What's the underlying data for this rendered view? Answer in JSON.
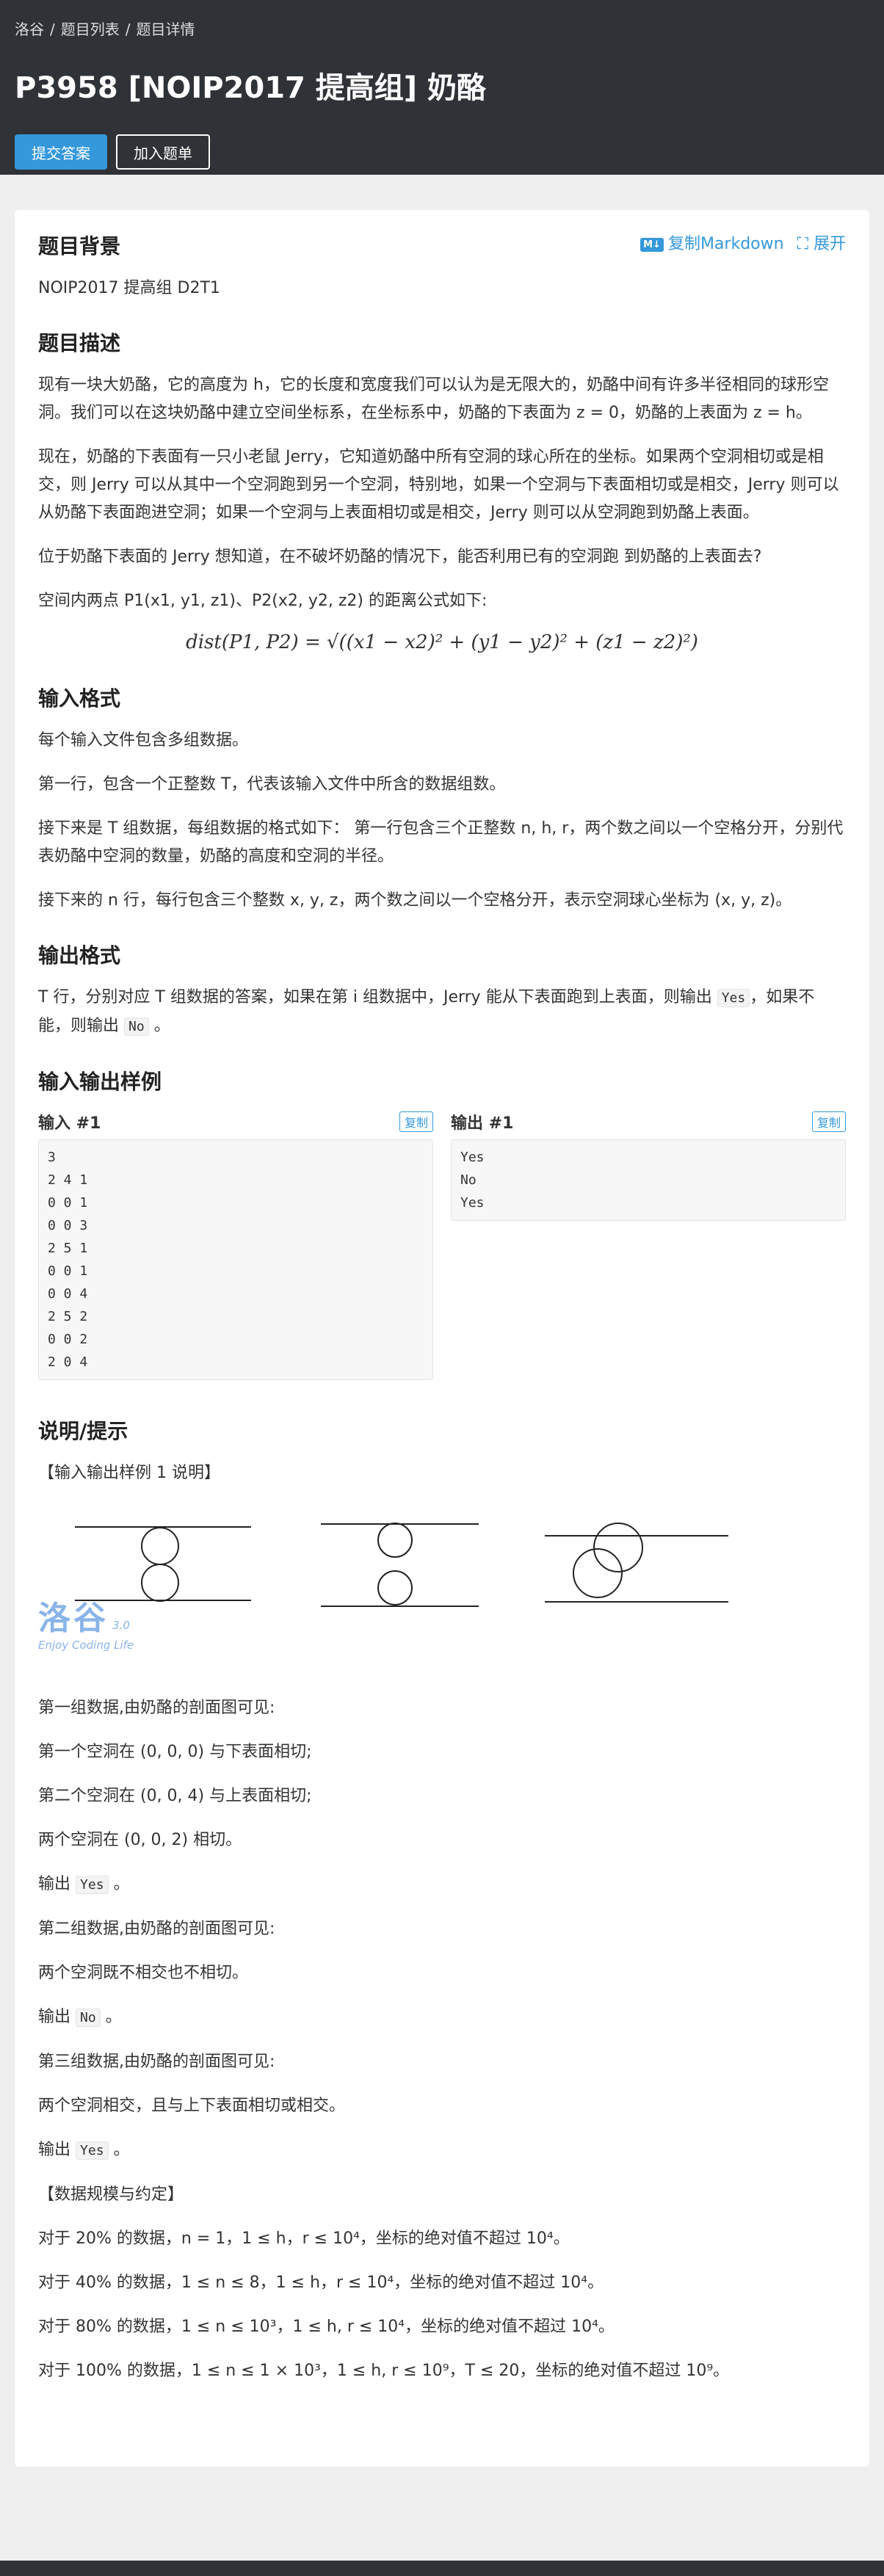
{
  "breadcrumb": [
    "洛谷",
    "题目列表",
    "题目详情"
  ],
  "title": "P3958 [NOIP2017 提高组] 奶酪",
  "actions": {
    "submit": "提交答案",
    "add": "加入题单"
  },
  "tools": {
    "md_badge": "M↓",
    "copy_md": "复制Markdown",
    "expand": "展开"
  },
  "background": {
    "title": "题目背景",
    "text": "NOIP2017 提高组 D2T1"
  },
  "description": {
    "title": "题目描述",
    "p1": "现有一块大奶酪，它的高度为 h，它的长度和宽度我们可以认为是无限大的，奶酪中间有许多半径相同的球形空洞。我们可以在这块奶酪中建立空间坐标系，在坐标系中，奶酪的下表面为 z = 0，奶酪的上表面为 z = h。",
    "p2": "现在，奶酪的下表面有一只小老鼠 Jerry，它知道奶酪中所有空洞的球心所在的坐标。如果两个空洞相切或是相交，则 Jerry 可以从其中一个空洞跑到另一个空洞，特别地，如果一个空洞与下表面相切或是相交，Jerry 则可以从奶酪下表面跑进空洞；如果一个空洞与上表面相切或是相交，Jerry 则可以从空洞跑到奶酪上表面。",
    "p3": "位于奶酪下表面的 Jerry 想知道，在不破坏奶酪的情况下，能否利用已有的空洞跑 到奶酪的上表面去?",
    "p4": "空间内两点 P1(x1, y1, z1)、P2(x2, y2, z2) 的距离公式如下:",
    "formula": "dist(P1, P2) = √((x1 − x2)² + (y1 − y2)² + (z1 − z2)²)"
  },
  "input_format": {
    "title": "输入格式",
    "p1": "每个输入文件包含多组数据。",
    "p2": "第一行，包含一个正整数 T，代表该输入文件中所含的数据组数。",
    "p3": "接下来是 T 组数据，每组数据的格式如下： 第一行包含三个正整数 n, h, r，两个数之间以一个空格分开，分别代表奶酪中空洞的数量，奶酪的高度和空洞的半径。",
    "p4": "接下来的 n 行，每行包含三个整数 x, y, z，两个数之间以一个空格分开，表示空洞球心坐标为 (x, y, z)。"
  },
  "output_format": {
    "title": "输出格式",
    "pre": "T 行，分别对应 T 组数据的答案，如果在第 i 组数据中，Jerry 能从下表面跑到上表面，则输出",
    "yes": "Yes",
    "mid": "，如果不能，则输出",
    "no": "No",
    "end": "。"
  },
  "samples": {
    "title": "输入输出样例",
    "input_title": "输入 #1",
    "output_title": "输出 #1",
    "copy": "复制",
    "input": "3\n2 4 1\n0 0 1\n0 0 3\n2 5 1\n0 0 1\n0 0 4\n2 5 2\n0 0 2\n2 0 4",
    "output": "Yes\nNo\nYes"
  },
  "hint": {
    "title": "说明/提示",
    "sample_expl": "【输入输出样例 1 说明】",
    "watermark_main": "洛谷",
    "watermark_sub": "Enjoy Coding Life",
    "watermark_ver": "3.0",
    "g1_intro": "第一组数据,由奶酪的剖面图可见:",
    "g1_a": "第一个空洞在 (0, 0, 0) 与下表面相切;",
    "g1_b": "第二个空洞在 (0, 0, 4) 与上表面相切;",
    "g1_c": "两个空洞在 (0, 0, 2) 相切。",
    "out_label": "输出",
    "out_end": "。",
    "g1_out": "Yes",
    "g2_intro": "第二组数据,由奶酪的剖面图可见:",
    "g2_a": "两个空洞既不相交也不相切。",
    "g2_out": "No",
    "g3_intro": "第三组数据,由奶酪的剖面图可见:",
    "g3_a": "两个空洞相交，且与上下表面相切或相交。",
    "g3_out": "Yes",
    "limits_title": "【数据规模与约定】",
    "l1": "对于 20% 的数据，n = 1，1 ≤ h，r ≤ 10⁴，坐标的绝对值不超过 10⁴。",
    "l2": "对于 40% 的数据，1 ≤ n ≤ 8，1 ≤ h，r ≤ 10⁴，坐标的绝对值不超过 10⁴。",
    "l3": "对于 80% 的数据，1 ≤ n ≤ 10³，1 ≤ h, r ≤ 10⁴，坐标的绝对值不超过 10⁴。",
    "l4": "对于 100% 的数据，1 ≤ n ≤ 1 × 10³，1 ≤ h, r ≤ 10⁹，T ≤ 20，坐标的绝对值不超过 10⁹。"
  }
}
